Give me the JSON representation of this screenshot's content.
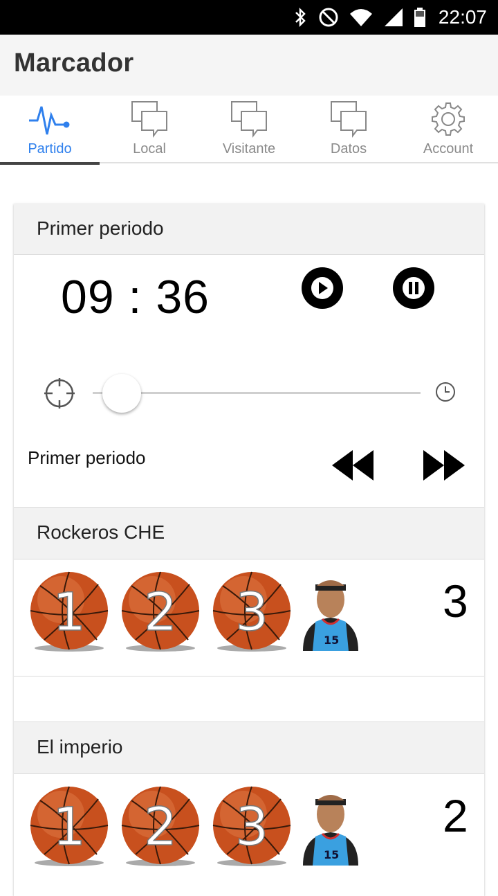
{
  "status_bar": {
    "time": "22:07"
  },
  "appbar": {
    "title": "Marcador"
  },
  "tabs": [
    {
      "label": "Partido",
      "icon": "pulse-icon",
      "active": true
    },
    {
      "label": "Local",
      "icon": "chat-icon",
      "active": false
    },
    {
      "label": "Visitante",
      "icon": "chat-icon",
      "active": false
    },
    {
      "label": "Datos",
      "icon": "chat-icon",
      "active": false
    },
    {
      "label": "Account",
      "icon": "gear-icon",
      "active": false
    }
  ],
  "period_section": {
    "header": "Primer periodo",
    "timer": "09 : 36",
    "period_label": "Primer periodo",
    "slider_value": 0.05
  },
  "teams": [
    {
      "name": "Rockeros CHE",
      "score": "3",
      "ball_numbers": [
        "1",
        "2",
        "3"
      ]
    },
    {
      "name": "El imperio",
      "score": "2",
      "ball_numbers": [
        "1",
        "2",
        "3"
      ]
    }
  ],
  "colors": {
    "accent": "#2f80ed",
    "ball": "#c8501e",
    "header_bg": "#f2f2f2"
  }
}
